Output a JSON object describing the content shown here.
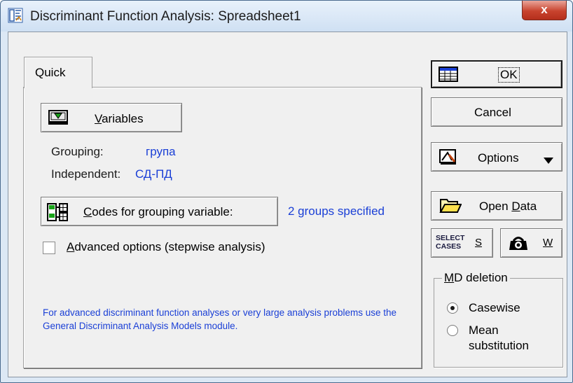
{
  "window": {
    "title": "Discriminant Function Analysis: Spreadsheet1",
    "close_label": "x"
  },
  "tabs": [
    {
      "label": "Quick"
    }
  ],
  "quick": {
    "variables_button": {
      "label": "Variables",
      "mnemonic": "V"
    },
    "grouping": {
      "label": "Grouping:",
      "value": "група"
    },
    "independent": {
      "label": "Independent:",
      "value": "СД-ПД"
    },
    "codes_button": {
      "label": "Codes for grouping variable:",
      "mnemonic": "C"
    },
    "groups_status": "2 groups specified",
    "advanced_checkbox": {
      "label": "Advanced options (stepwise analysis)",
      "checked": false,
      "mnemonic": "A"
    },
    "note": "For advanced discriminant function analyses or very large analysis problems use the General Discriminant Analysis Models module."
  },
  "side": {
    "ok_label": "OK",
    "cancel_label": "Cancel",
    "options_label": "Options",
    "open_data_label": "Open Data",
    "open_data_mnemonic": "D",
    "select_cases_icon_text": [
      "SELECT",
      "CASES"
    ],
    "select_cases_label": "S",
    "weight_label": "W"
  },
  "md_deletion": {
    "title": "MD deletion",
    "options": [
      {
        "label": "Casewise",
        "selected": true
      },
      {
        "label": "Mean substitution",
        "selected": false
      }
    ]
  },
  "colors": {
    "accent_text": "#1a3fd6",
    "window_frame": "#dce8f5",
    "face": "#f0f0f0",
    "close_button": "#c8432e"
  },
  "icons": {
    "app": "discriminant-analysis-icon",
    "variables": "variables-icon",
    "codes": "codes-grid-icon",
    "ok": "spreadsheet-icon",
    "options": "options-icon",
    "open_data": "folder-open-icon",
    "select_cases": "select-cases-icon",
    "weight": "weight-icon",
    "dropdown": "triangle-down-icon"
  }
}
